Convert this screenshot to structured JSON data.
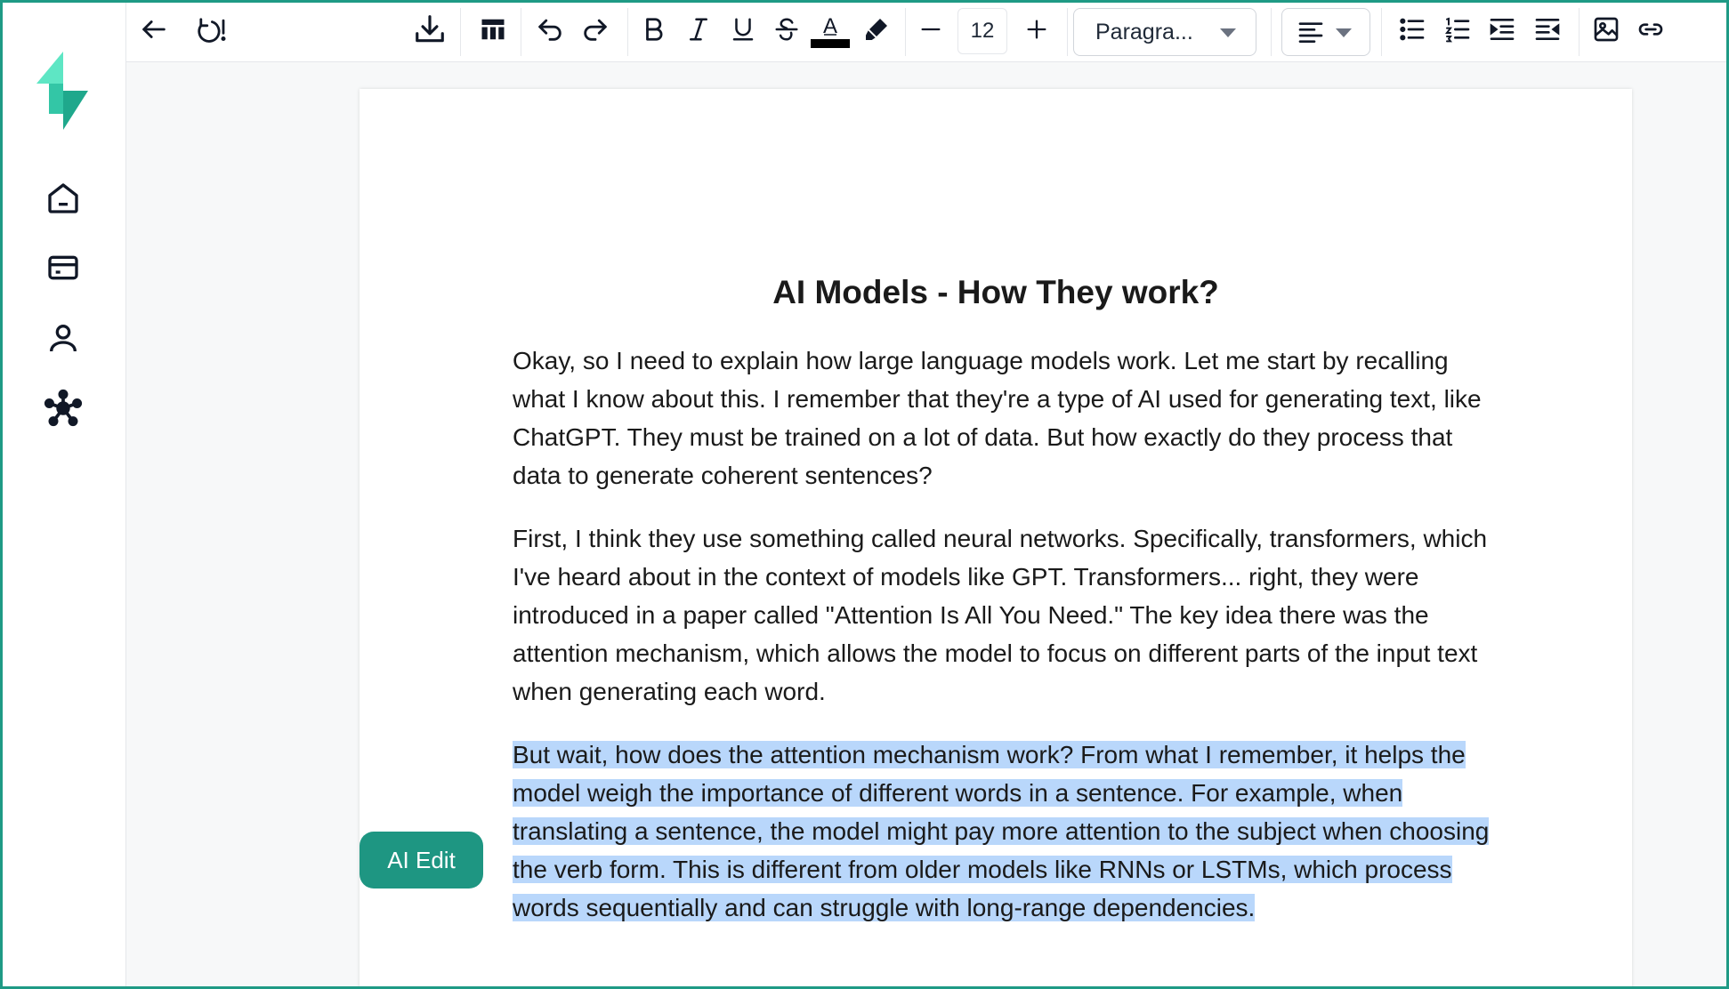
{
  "toolbar": {
    "font_size": "12",
    "paragraph_style": "Paragra...",
    "text_color": "#000000"
  },
  "document": {
    "title": "AI Models - How They work?",
    "paragraphs": [
      "Okay, so I need to explain how large language models work. Let me start by recalling what I know about this. I remember that they're a type of AI used for generating text, like ChatGPT. They must be trained on a lot of data. But how exactly do they process that data to generate coherent sentences?",
      "First, I think they use something called neural networks. Specifically, transformers, which I've heard about in the context of models like GPT. Transformers... right, they were introduced in a paper called \"Attention Is All You Need.\" The key idea there was the attention mechanism, which allows the model to focus on different parts of the input text when generating each word.",
      "But wait, how does the attention mechanism work? From what I remember, it helps the model weigh the importance of different words in a sentence. For example, when translating a sentence, the model might pay more attention to the subject when choosing the verb form. This is different from older models like RNNs or LSTMs, which process words sequentially and can struggle with long-range dependencies."
    ],
    "selected_paragraph_index": 2
  },
  "ai_edit": {
    "label": "AI Edit"
  },
  "colors": {
    "brand": "#1e9682",
    "frame_border": "#1f9a85",
    "selection": "#b9d7fb",
    "logo_light": "#5ee6c4",
    "logo_dark": "#1fa88c"
  },
  "icons": {
    "sidebar": [
      "home-icon",
      "card-icon",
      "user-icon",
      "network-icon"
    ],
    "toolbar": [
      "back-arrow-icon",
      "revision-history-icon",
      "download-icon",
      "table-icon",
      "undo-icon",
      "redo-icon",
      "bold-icon",
      "italic-icon",
      "underline-icon",
      "strikethrough-icon",
      "text-color-icon",
      "highlight-icon",
      "decrease-font-icon",
      "increase-font-icon",
      "align-left-icon",
      "bullet-list-icon",
      "numbered-list-icon",
      "indent-icon",
      "outdent-icon",
      "image-icon",
      "link-icon"
    ]
  }
}
